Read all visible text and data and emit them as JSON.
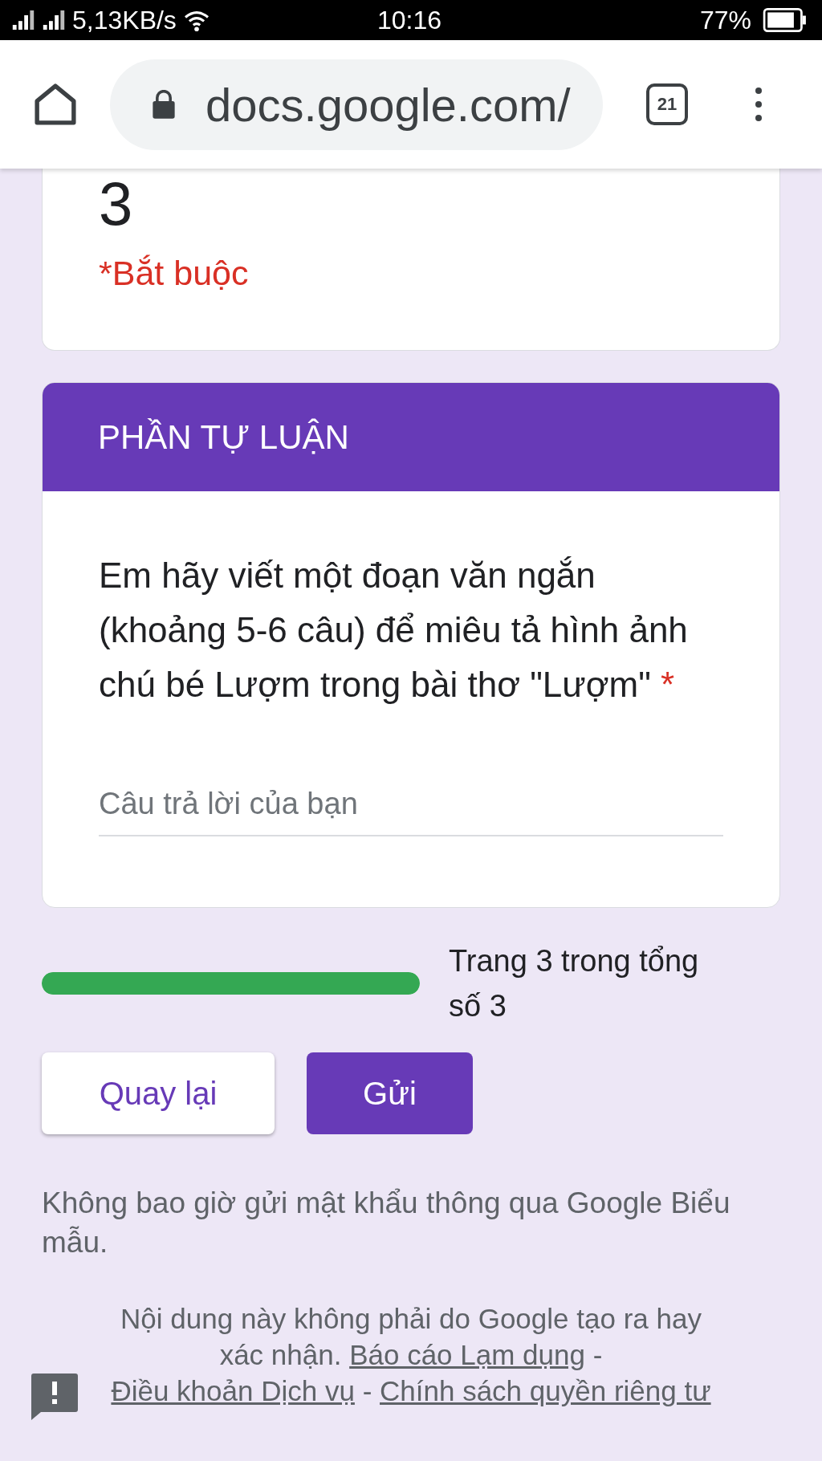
{
  "status_bar": {
    "network_speed": "5,13KB/s",
    "time": "10:16",
    "battery": "77%"
  },
  "browser": {
    "url": "docs.google.com/",
    "tab_count": "21"
  },
  "form_header": {
    "title": "3",
    "required_note": "*Bắt buộc"
  },
  "section": {
    "title": "PHẦN TỰ LUẬN",
    "question": {
      "text": "Em hãy viết một đoạn văn ngắn (khoảng 5-6 câu) để miêu tả hình ảnh chú bé Lượm trong bài thơ \"Lượm\"",
      "required": true,
      "required_mark": "*",
      "placeholder": "Câu trả lời của bạn"
    }
  },
  "progress": {
    "level": 1,
    "label": "Trang 3 trong tổng số 3"
  },
  "buttons": [
    {
      "label": "Quay lại",
      "kind": "secondary"
    },
    {
      "label": "Gửi",
      "kind": "primary"
    }
  ],
  "footer": {
    "password_warning": "Không bao giờ gửi mật khẩu thông qua Google Biểu mẫu.",
    "disclaimer": [
      {
        "kind": "text",
        "text": "Nội dung này không phải do Google tạo ra hay xác nhận. "
      },
      {
        "kind": "link",
        "text": "Báo cáo Lạm dụng"
      },
      {
        "kind": "text",
        "text": " - "
      },
      {
        "kind": "link",
        "text": "Điều khoản Dịch vụ"
      },
      {
        "kind": "text",
        "text": " - "
      },
      {
        "kind": "link",
        "text": "Chính sách quyền riêng tư"
      }
    ]
  }
}
